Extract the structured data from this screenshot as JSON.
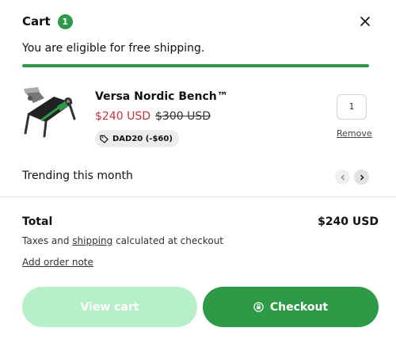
{
  "cart": {
    "title": "Cart",
    "count": "1",
    "shipping_message": "You are eligible for free shipping.",
    "shipping_progress": 1.0
  },
  "item": {
    "name": "Versa Nordic Bench™",
    "sale_price": "$240 USD",
    "original_price": "$300 USD",
    "discount": "DAD20 (-$60)",
    "quantity": "1",
    "remove_label": "Remove"
  },
  "trending": {
    "label": "Trending this month"
  },
  "summary": {
    "total_label": "Total",
    "total_value": "$240 USD",
    "tax_prefix": "Taxes and ",
    "tax_link": "shipping",
    "tax_suffix": " calculated at checkout",
    "order_note": "Add order note"
  },
  "buttons": {
    "view_cart": "View cart",
    "checkout": "Checkout"
  },
  "colors": {
    "accent": "#2e9a47",
    "accent_light": "#b7f0c8",
    "sale": "#c6303e"
  },
  "icons": {
    "close": "close-icon",
    "tag": "tag-icon",
    "prev": "chevron-left-icon",
    "next": "chevron-right-icon",
    "lock": "lock-icon"
  }
}
